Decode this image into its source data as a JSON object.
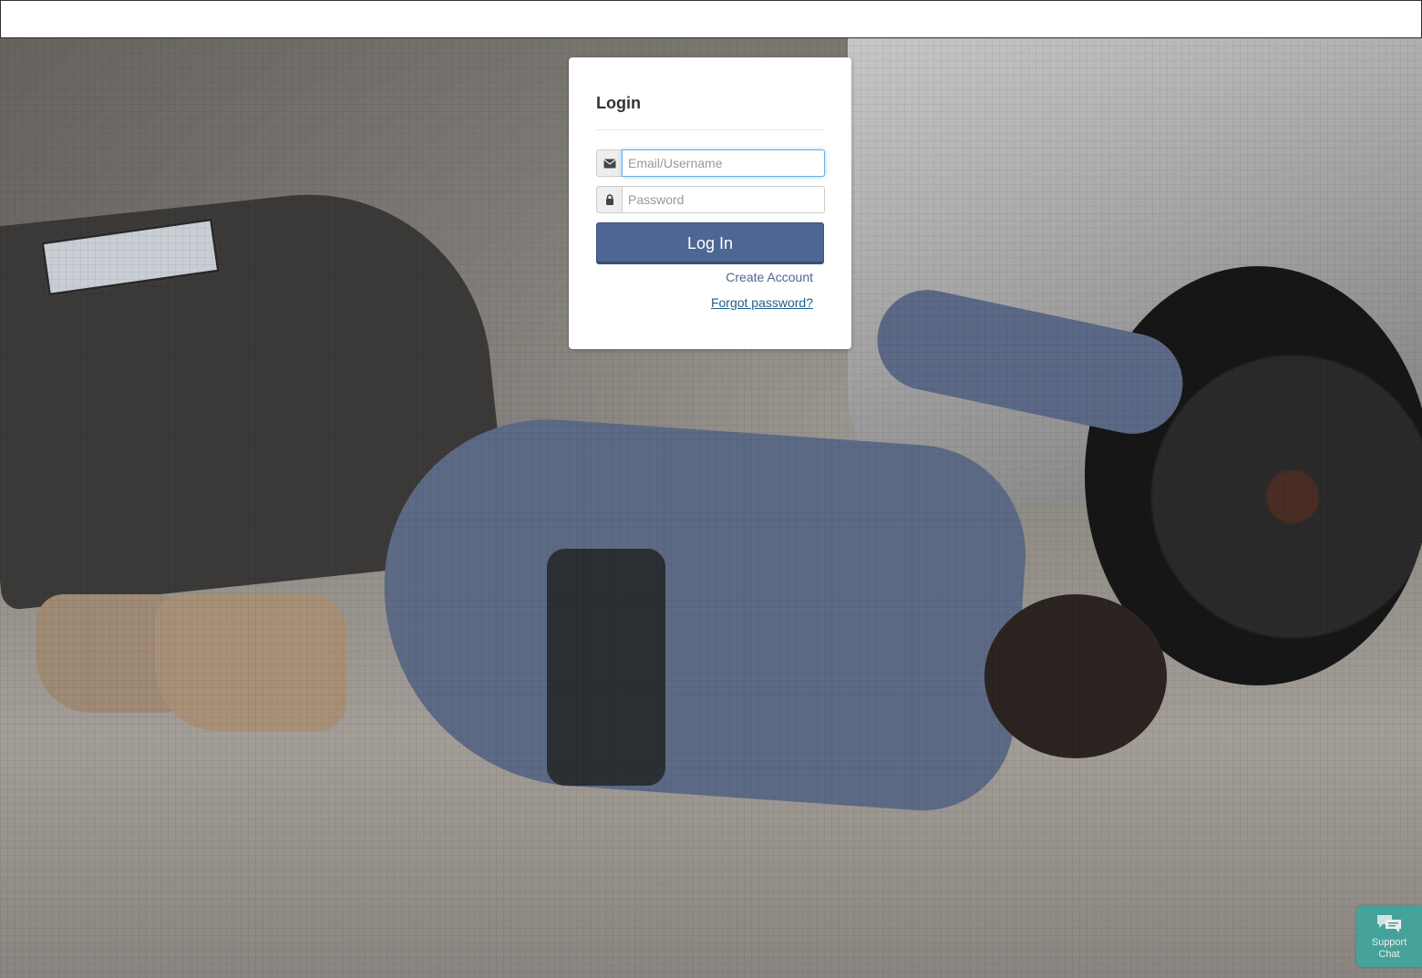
{
  "login": {
    "title": "Login",
    "email_placeholder": "Email/Username",
    "password_placeholder": "Password",
    "login_button": "Log In",
    "create_account": "Create Account",
    "forgot_password": "Forgot password?"
  },
  "icons": {
    "email": "envelope-icon",
    "password": "lock-icon",
    "chat": "chat-bubbles-icon"
  },
  "support_chat": {
    "line1": "Support",
    "line2": "Chat"
  },
  "colors": {
    "primary_button": "#4d6694",
    "link": "#4d6694",
    "support_chat": "#3aa8a0"
  }
}
